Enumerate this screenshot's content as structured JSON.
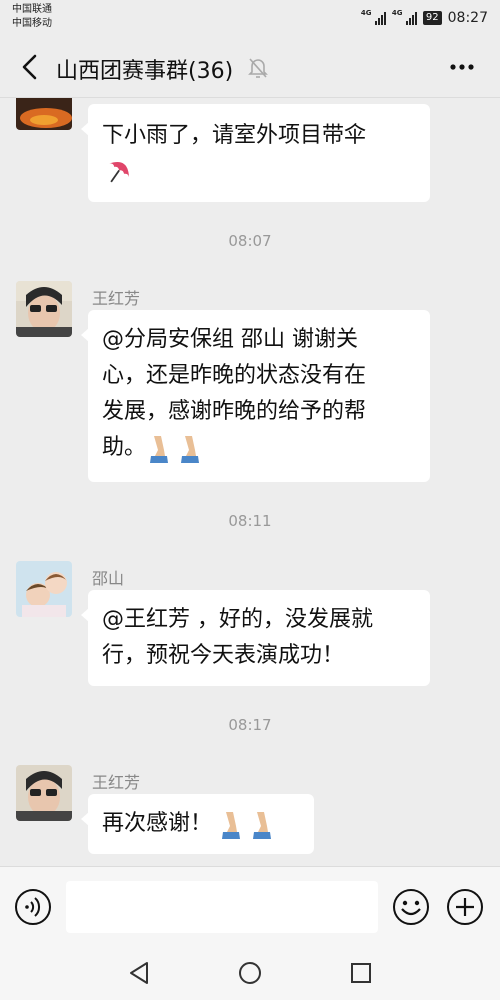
{
  "status_bar": {
    "carrier1": "中国联通",
    "carrier2": "中国移动",
    "network1": "4G",
    "network2": "4G",
    "battery": "92",
    "time": "08:27"
  },
  "header": {
    "title": "山西团赛事群(36)",
    "back_icon": "chevron-left-icon",
    "mute_icon": "bell-off-icon",
    "more_icon": "ellipsis-icon"
  },
  "messages": [
    {
      "sender": "",
      "text": "下小雨了，请室外项目带伞",
      "emoji": "umbrella-icon"
    },
    {
      "time": "08:07"
    },
    {
      "sender": "王红芳",
      "text": "@分局安保组 邵山  谢谢关心，还是昨晚的状态没有在发展，感谢昨晚的给予的帮助。",
      "emoji": "praying-hands-icon"
    },
    {
      "time": "08:11"
    },
    {
      "sender": "邵山",
      "text": "@王红芳 ，好的，没发展就行，预祝今天表演成功！"
    },
    {
      "time": "08:17"
    },
    {
      "sender": "王红芳",
      "text": "再次感谢！",
      "emoji": "praying-hands-icon"
    }
  ],
  "m0": {
    "line1": "下小雨了，请室外项目带伞"
  },
  "t1": "08:07",
  "m2": {
    "sender": "王红芳",
    "line1": "@分局安保组  邵山   谢谢关",
    "line2": "心，还是昨晚的状态没有在",
    "line3": "发展，感谢昨晚的给予的帮",
    "line4": "助。"
  },
  "t3": "08:11",
  "m4": {
    "sender": "邵山",
    "line1": "@王红芳 ，好的，没发展就",
    "line2": "行，预祝今天表演成功！"
  },
  "t5": "08:17",
  "m6": {
    "sender": "王红芳",
    "line1": "再次感谢！"
  },
  "input_bar": {
    "placeholder": "",
    "voice_icon": "voice-icon",
    "emoji_icon": "smile-icon",
    "plus_icon": "plus-circle-icon"
  },
  "nav_bar": {
    "back_icon": "triangle-back-icon",
    "home_icon": "circle-home-icon",
    "recent_icon": "square-recent-icon"
  },
  "colors": {
    "background": "#ededed",
    "bubble": "#ffffff",
    "text": "#111111",
    "muted": "#999999"
  }
}
